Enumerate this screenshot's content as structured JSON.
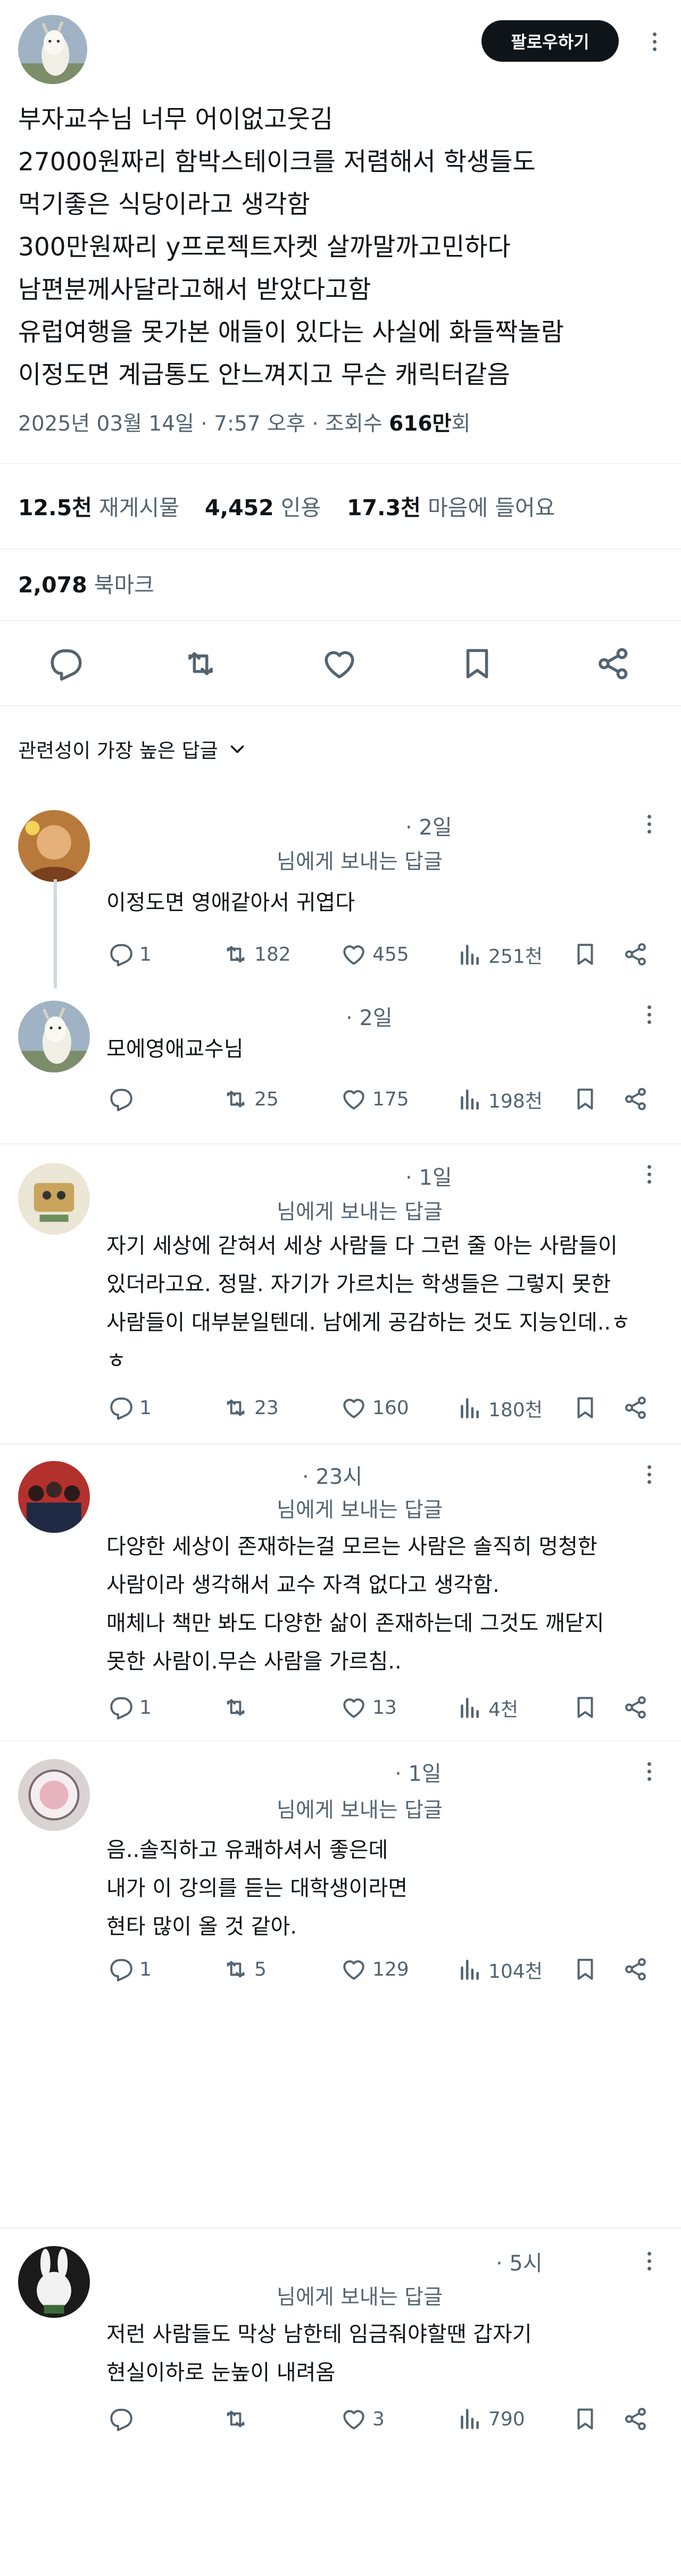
{
  "header": {
    "follow_label": "팔로우하기"
  },
  "post": {
    "lines": [
      "부자교수님 너무 어이없고웃김",
      "27000원짜리 함박스테이크를 저렴해서 학생들도",
      "먹기좋은 식당이라고 생각함",
      "300만원짜리 y프로젝트자켓 살까말까고민하다",
      "남편분께사달라고해서 받았다고함",
      "유럽여행을 못가본 애들이 있다는 사실에 화들짝놀람",
      "이정도면 계급통도 안느껴지고 무슨 캐릭터같음"
    ],
    "meta_date": "2025년 03월 14일 · 7:57 오후 · 조회수 ",
    "meta_views": "616만",
    "meta_views_suffix": "회"
  },
  "stats": {
    "reposts_value": "12.5천",
    "reposts_label": "재게시물",
    "quotes_value": "4,452",
    "quotes_label": "인용",
    "likes_value": "17.3천",
    "likes_label": "마음에 들어요",
    "bookmarks_value": "2,078",
    "bookmarks_label": "북마크"
  },
  "sort": {
    "label": "관련성이 가장 높은 답글"
  },
  "replies": [
    {
      "time": "· 2일",
      "reply_to": "님에게 보내는 답글",
      "lines": [
        "이정도면 영애같아서 귀엽다"
      ],
      "comments": "1",
      "reposts": "182",
      "likes": "455",
      "views": "251천"
    },
    {
      "time": "· 2일",
      "reply_to": "",
      "lines": [
        "모에영애교수님"
      ],
      "comments": "",
      "reposts": "25",
      "likes": "175",
      "views": "198천"
    },
    {
      "time": "· 1일",
      "reply_to": "님에게 보내는 답글",
      "lines": [
        "자기 세상에 갇혀서 세상 사람들 다 그런 줄 아는 사람들이",
        "있더라고요. 정말. 자기가 가르치는 학생들은 그렇지 못한",
        "사람들이 대부분일텐데. 남에게 공감하는 것도 지능인데..ㅎ",
        "ㅎ"
      ],
      "comments": "1",
      "reposts": "23",
      "likes": "160",
      "views": "180천"
    },
    {
      "time": "· 23시",
      "reply_to": "님에게 보내는 답글",
      "lines": [
        "다양한 세상이 존재하는걸 모르는 사람은 솔직히 멍청한",
        "사람이라 생각해서 교수 자격 없다고 생각함.",
        "매체나 책만 봐도 다양한 삶이 존재하는데 그것도 깨닫지",
        "못한 사람이.무슨 사람을 가르침.."
      ],
      "comments": "1",
      "reposts": "",
      "likes": "13",
      "views": "4천"
    },
    {
      "time": "· 1일",
      "reply_to": "님에게 보내는 답글",
      "lines": [
        "음..솔직하고 유쾌하셔서 좋은데",
        "내가 이 강의를 듣는 대학생이라면",
        "현타 많이 올 것 같아."
      ],
      "comments": "1",
      "reposts": "5",
      "likes": "129",
      "views": "104천"
    },
    {
      "time": "· 5시",
      "reply_to": "님에게 보내는 답글",
      "lines": [
        "저런 사람들도 막상 남한테 임금줘야할땐 갑자기",
        "현실이하로 눈높이 내려옴"
      ],
      "comments": "",
      "reposts": "",
      "likes": "3",
      "views": "790"
    }
  ],
  "colors": {
    "text": "#0f1419",
    "secondary": "#536471",
    "divider": "#eff3f4",
    "button": "#0f1419"
  },
  "icons": [
    "goat-avatar",
    "more-icon",
    "reply-icon",
    "repost-icon",
    "like-icon",
    "bookmark-icon",
    "share-icon",
    "views-icon",
    "chevron-down-icon"
  ]
}
